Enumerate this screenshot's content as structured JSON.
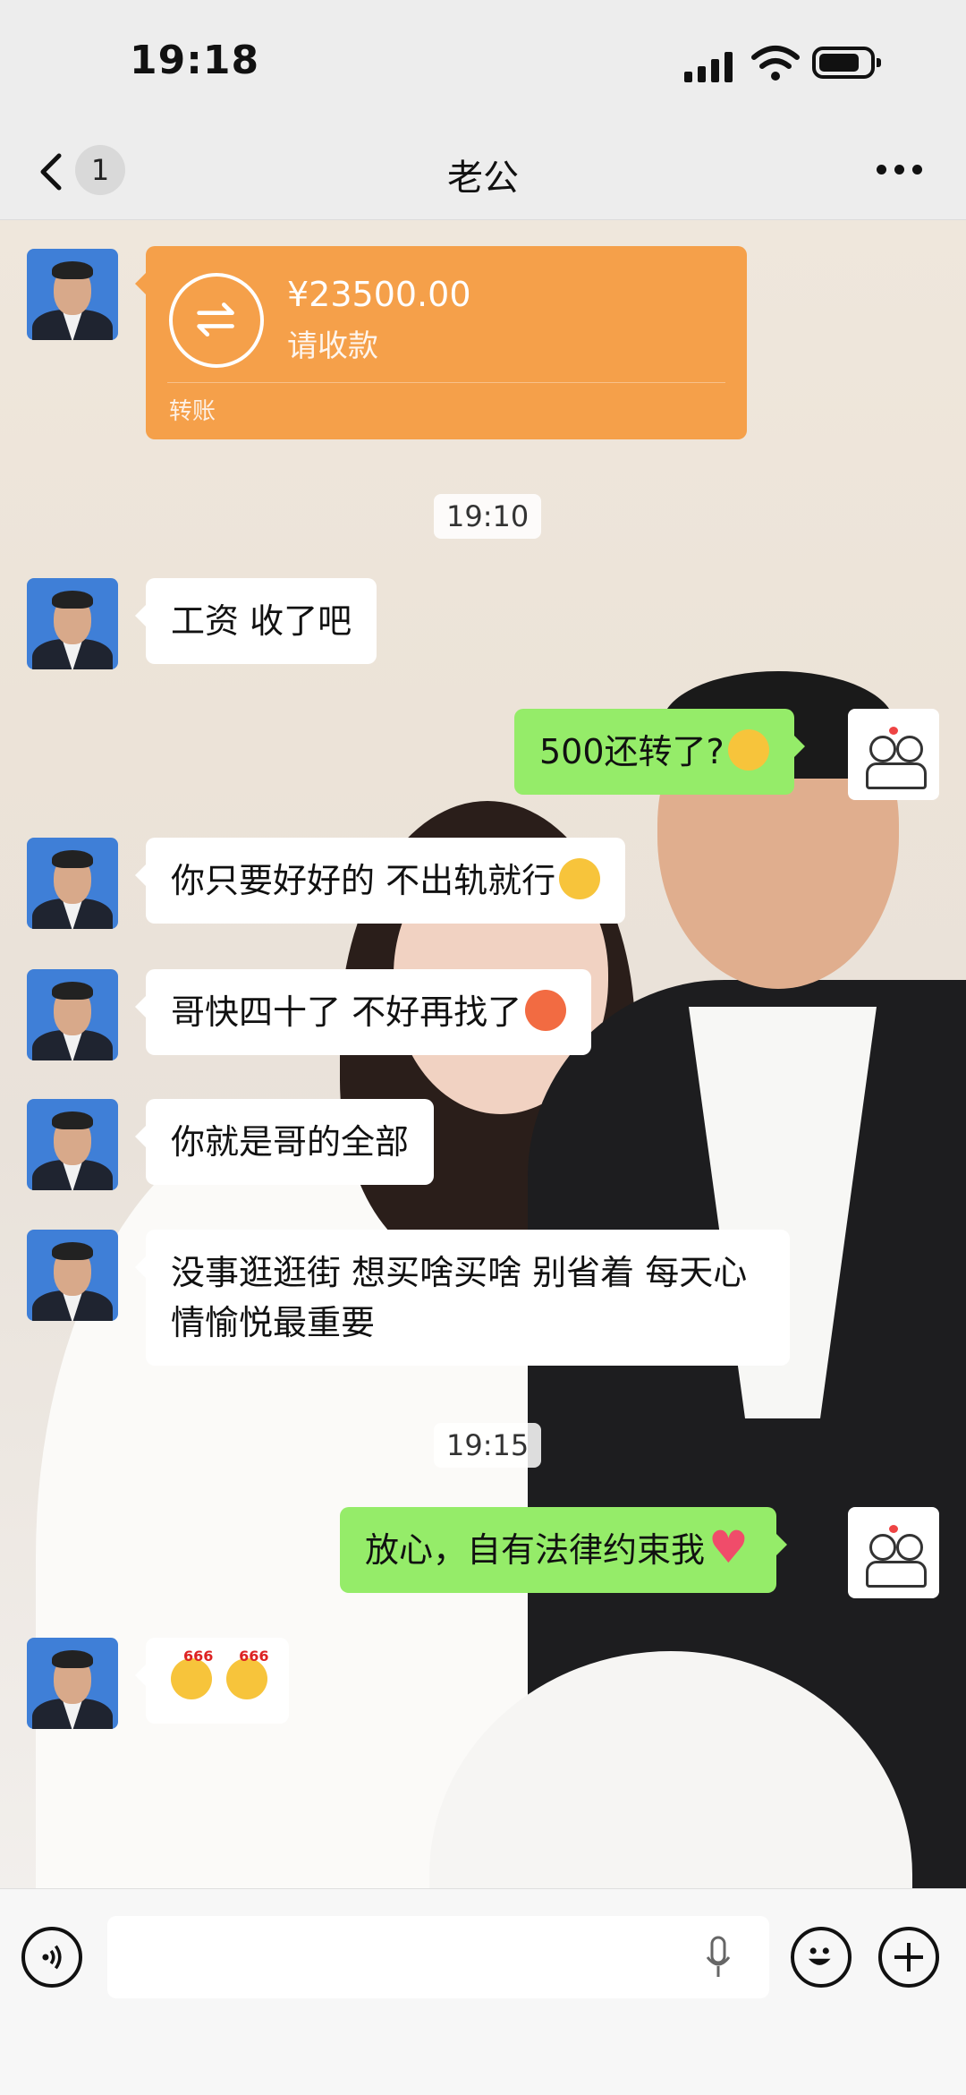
{
  "status_bar": {
    "time": "19:18"
  },
  "nav": {
    "title": "老公",
    "unread_count": "1"
  },
  "transfer": {
    "amount": "¥23500.00",
    "note": "请收款",
    "label": "转账"
  },
  "timestamps": [
    "19:10",
    "19:15"
  ],
  "messages": {
    "m1": "工资 收了吧",
    "m2": "500还转了?",
    "m3": "你只要好好的  不出轨就行",
    "m4": "哥快四十了  不好再找了",
    "m5": "你就是哥的全部",
    "m6": "没事逛逛街 想买啥买啥   别省着  每天心情愉悦最重要",
    "m7": "放心，自有法律约束我",
    "m8_emoji_text": "666"
  },
  "icons": {
    "back": "chevron-left-icon",
    "more": "more-dots-icon",
    "transfer": "transfer-arrows-icon",
    "voice": "voice-icon",
    "mic": "microphone-icon",
    "emoji": "emoji-icon",
    "plus": "plus-icon"
  },
  "colors": {
    "outgoing_bubble": "#95ec69",
    "transfer_card": "#f5a04a",
    "incoming_bubble": "#ffffff"
  }
}
